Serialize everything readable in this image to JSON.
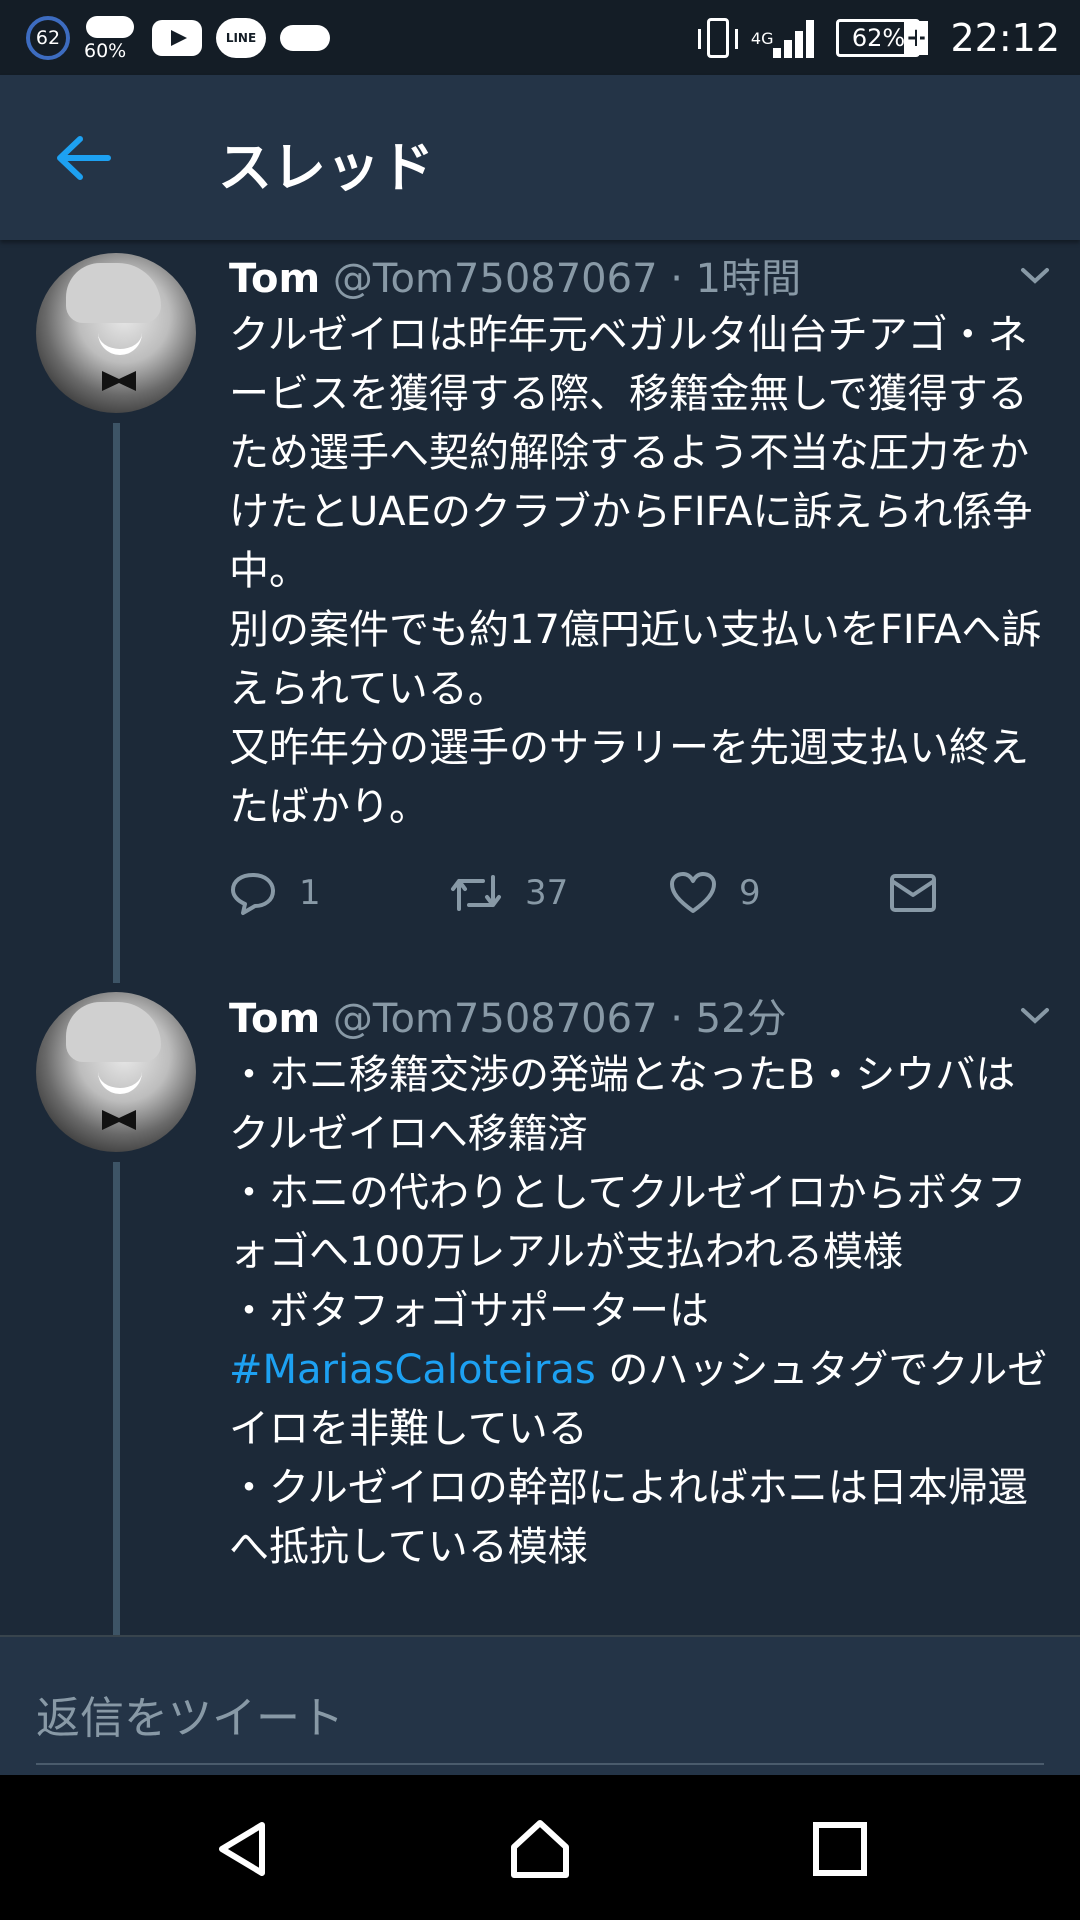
{
  "status_bar": {
    "notification_count": "62",
    "weather_percent": "60%",
    "line_label": "LINE",
    "network": "4G",
    "battery": "62%",
    "time": "22:12"
  },
  "header": {
    "title": "スレッド"
  },
  "tweets": [
    {
      "name": "Tom",
      "handle": "@Tom75087067 · 1時間",
      "text": "クルゼイロは昨年元ベガルタ仙台チアゴ・ネービスを獲得する際、移籍金無しで獲得するため選手へ契約解除するよう不当な圧力をかけたとUAEのクラブからFIFAに訴えられ係争中。\n別の案件でも約17億円近い支払いをFIFAへ訴えられている。\n又昨年分の選手のサラリーを先週支払い終えたばかり。",
      "replies": "1",
      "retweets": "37",
      "likes": "9"
    },
    {
      "name": "Tom",
      "handle": "@Tom75087067 · 52分",
      "text_part1": "・ホニ移籍交渉の発端となったB・シウバはクルゼイロへ移籍済\n・ホニの代わりとしてクルゼイロからボタフォゴへ100万レアルが支払われる模様\n・ボタフォゴサポーターは\n",
      "hashtag": "#MariasCaloteiras",
      "text_part2": " のハッシュタグでクルゼイロを非難している\n・クルゼイロの幹部によればホニは日本帰還へ抵抗している模様"
    }
  ],
  "reply_bar": {
    "placeholder": "返信をツイート"
  },
  "colors": {
    "background": "#1c2938",
    "header": "#243447",
    "accent": "#1da1f2",
    "muted": "#8899a6"
  }
}
